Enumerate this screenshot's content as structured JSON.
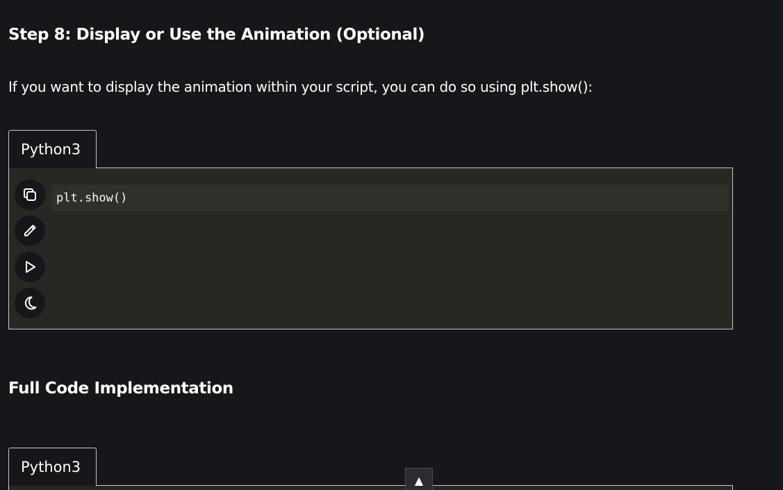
{
  "sections": {
    "step8_heading": "Step 8: Display or Use the Animation (Optional)",
    "step8_paragraph": "If you want to display the animation within your script, you can do so using plt.show():",
    "full_code_heading": "Full Code Implementation"
  },
  "code_block_1": {
    "tab_label": "Python3",
    "code": "plt.show()",
    "tools": [
      {
        "name": "copy",
        "icon": "copy-icon"
      },
      {
        "name": "edit",
        "icon": "pencil-icon"
      },
      {
        "name": "run",
        "icon": "play-icon"
      },
      {
        "name": "theme",
        "icon": "moon-icon"
      }
    ]
  },
  "code_block_2": {
    "tab_label": "Python3"
  },
  "scroll_to_top": {
    "glyph": "▲"
  },
  "colors": {
    "background": "#16171b",
    "code_background": "#272822",
    "code_line_highlight": "#2f302a",
    "border": "#c9c9c9",
    "text": "#ffffff"
  }
}
